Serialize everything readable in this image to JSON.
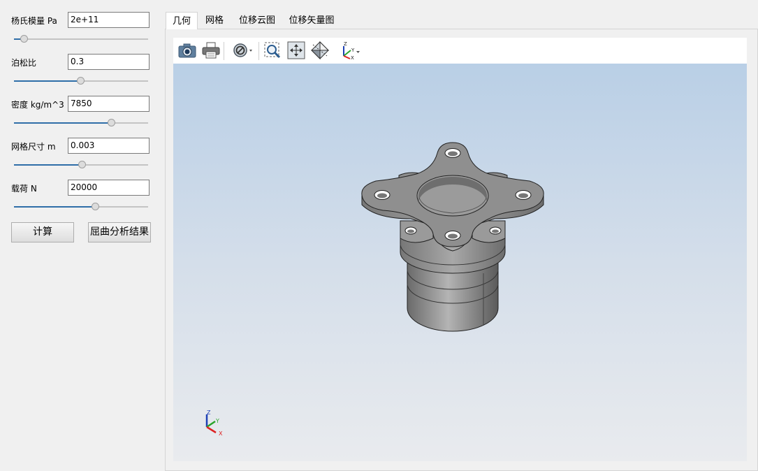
{
  "params": [
    {
      "label": "杨氏模量 Pa",
      "value": "2e+11",
      "slider": 0.08
    },
    {
      "label": "泊松比",
      "value": "0.3",
      "slider": 0.5
    },
    {
      "label": "密度 kg/m^3",
      "value": "7850",
      "slider": 0.73
    },
    {
      "label": "网格尺寸 m",
      "value": "0.003",
      "slider": 0.51
    },
    {
      "label": "载荷 N",
      "value": "20000",
      "slider": 0.61
    }
  ],
  "buttons": {
    "compute": "计算",
    "buckling": "屈曲分析结果"
  },
  "tabs": [
    "几何",
    "网格",
    "位移云图",
    "位移矢量图"
  ],
  "active_tab": "几何",
  "toolbar_icons": [
    "camera-icon",
    "print-icon",
    "section-view-icon",
    "zoom-box-icon",
    "fit-all-icon",
    "view-cube-icon",
    "axes-icon"
  ],
  "axes": {
    "x": "X",
    "y": "Y",
    "z": "Z"
  },
  "colors": {
    "accent": "#2f6ea8",
    "viewport_top": "#b9cfe6",
    "viewport_bottom": "#e9ebee",
    "model_gray": "#8c8c8c"
  }
}
